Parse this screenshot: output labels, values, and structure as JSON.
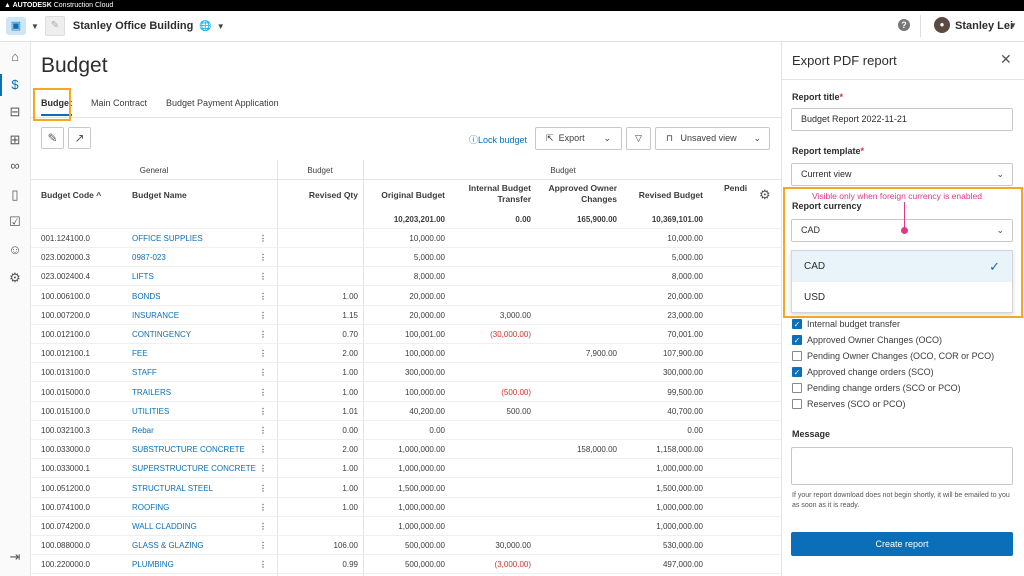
{
  "brand": {
    "logo_mark": "▲",
    "name": "AUTODESK",
    "product": "Construction Cloud"
  },
  "header": {
    "project_name": "Stanley Office Building",
    "user_name": "Stanley Lei",
    "icons": [
      "app-switcher-icon",
      "globe-icon",
      "help-icon",
      "avatar"
    ]
  },
  "page": {
    "title": "Budget"
  },
  "tabs": [
    {
      "label": "Budget",
      "active": true
    },
    {
      "label": "Main Contract",
      "active": false
    },
    {
      "label": "Budget Payment Application",
      "active": false
    }
  ],
  "toolbar": {
    "lock_label": "Lock budget",
    "export_label": "Export",
    "view_label": "Unsaved view"
  },
  "grid": {
    "group_general": "General",
    "group_budget1": "Budget",
    "group_budget2": "Budget",
    "columns": {
      "code": "Budget Code ^",
      "name": "Budget Name",
      "revised_qty": "Revised Qty",
      "original": "Original Budget",
      "internal_1": "Internal Budget",
      "internal_2": "Transfer",
      "approved_1": "Approved Owner",
      "approved_2": "Changes",
      "revised_budget": "Revised Budget",
      "pending": "Pendi"
    },
    "totals": {
      "original": "10,203,201.00",
      "internal": "0.00",
      "approved": "165,900.00",
      "revised_budget": "10,369,101.00"
    },
    "rows": [
      {
        "code": "001.124100.0",
        "name": "OFFICE SUPPLIES",
        "qty": "",
        "original": "10,000.00",
        "internal": "",
        "approved": "",
        "revised": "10,000.00"
      },
      {
        "code": "023.002000.3",
        "name": "0987-023",
        "qty": "",
        "original": "5,000.00",
        "internal": "",
        "approved": "",
        "revised": "5,000.00"
      },
      {
        "code": "023.002400.4",
        "name": "LIFTS",
        "qty": "",
        "original": "8,000.00",
        "internal": "",
        "approved": "",
        "revised": "8,000.00"
      },
      {
        "code": "100.006100.0",
        "name": "BONDS",
        "qty": "1.00",
        "original": "20,000.00",
        "internal": "",
        "approved": "",
        "revised": "20,000.00"
      },
      {
        "code": "100.007200.0",
        "name": "INSURANCE",
        "qty": "1.15",
        "original": "20,000.00",
        "internal": "3,000.00",
        "approved": "",
        "revised": "23,000.00"
      },
      {
        "code": "100.012100.0",
        "name": "CONTINGENCY",
        "qty": "0.70",
        "original": "100,001.00",
        "internal": "(30,000.00)",
        "approved": "",
        "revised": "70,001.00"
      },
      {
        "code": "100.012100.1",
        "name": "FEE",
        "qty": "2.00",
        "original": "100,000.00",
        "internal": "",
        "approved": "7,900.00",
        "revised": "107,900.00"
      },
      {
        "code": "100.013100.0",
        "name": "STAFF",
        "qty": "1.00",
        "original": "300,000.00",
        "internal": "",
        "approved": "",
        "revised": "300,000.00"
      },
      {
        "code": "100.015000.0",
        "name": "TRAILERS",
        "qty": "1.00",
        "original": "100,000.00",
        "internal": "(500.00)",
        "approved": "",
        "revised": "99,500.00"
      },
      {
        "code": "100.015100.0",
        "name": "UTILITIES",
        "qty": "1.01",
        "original": "40,200.00",
        "internal": "500.00",
        "approved": "",
        "revised": "40,700.00"
      },
      {
        "code": "100.032100.3",
        "name": "Rebar",
        "qty": "0.00",
        "original": "0.00",
        "internal": "",
        "approved": "",
        "revised": "0.00"
      },
      {
        "code": "100.033000.0",
        "name": "SUBSTRUCTURE CONCRETE",
        "qty": "2.00",
        "original": "1,000,000.00",
        "internal": "",
        "approved": "158,000.00",
        "revised": "1,158,000.00"
      },
      {
        "code": "100.033000.1",
        "name": "SUPERSTRUCTURE CONCRETE",
        "qty": "1.00",
        "original": "1,000,000.00",
        "internal": "",
        "approved": "",
        "revised": "1,000,000.00"
      },
      {
        "code": "100.051200.0",
        "name": "STRUCTURAL STEEL",
        "qty": "1.00",
        "original": "1,500,000.00",
        "internal": "",
        "approved": "",
        "revised": "1,500,000.00"
      },
      {
        "code": "100.074100.0",
        "name": "ROOFING",
        "qty": "1.00",
        "original": "1,000,000.00",
        "internal": "",
        "approved": "",
        "revised": "1,000,000.00"
      },
      {
        "code": "100.074200.0",
        "name": "WALL CLADDING",
        "qty": "",
        "original": "1,000,000.00",
        "internal": "",
        "approved": "",
        "revised": "1,000,000.00"
      },
      {
        "code": "100.088000.0",
        "name": "GLASS & GLAZING",
        "qty": "106.00",
        "original": "500,000.00",
        "internal": "30,000.00",
        "approved": "",
        "revised": "530,000.00"
      },
      {
        "code": "100.220000.0",
        "name": "PLUMBING",
        "qty": "0.99",
        "original": "500,000.00",
        "internal": "(3,000.00)",
        "approved": "",
        "revised": "497,000.00"
      }
    ]
  },
  "panel": {
    "title": "Export PDF report",
    "report_title_label": "Report title",
    "report_title_value": "Budget Report 2022-11-21",
    "template_label": "Report template",
    "template_value": "Current view",
    "annotation": "Visible only when foreign currency is enabled",
    "currency_label": "Report currency",
    "currency_value": "CAD",
    "currency_options": [
      {
        "label": "CAD",
        "selected": true
      },
      {
        "label": "USD",
        "selected": false
      }
    ],
    "checkboxes": [
      {
        "label": "Internal budget transfer",
        "checked": true
      },
      {
        "label": "Approved Owner Changes (OCO)",
        "checked": true
      },
      {
        "label": "Pending Owner Changes (OCO, COR or PCO)",
        "checked": false
      },
      {
        "label": "Approved change orders (SCO)",
        "checked": true
      },
      {
        "label": "Pending change orders (SCO or PCO)",
        "checked": false
      },
      {
        "label": "Reserves (SCO or PCO)",
        "checked": false
      }
    ],
    "message_label": "Message",
    "helper_text": "If your report download does not begin shortly, it will be emailed to you as soon as it is ready.",
    "create_label": "Create report"
  },
  "colors": {
    "accent": "#0a6fb8",
    "highlight": "#f5a623",
    "annotation": "#e0368e",
    "negative": "#d0342c"
  }
}
